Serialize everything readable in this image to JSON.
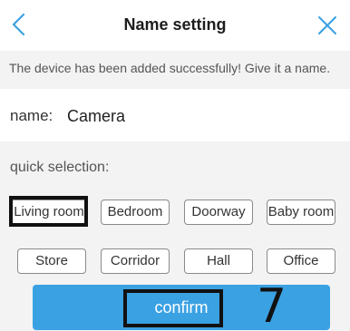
{
  "header": {
    "title": "Name setting",
    "back_icon": "chevron-left-icon",
    "close_icon": "close-icon",
    "accent_color": "#3aa1e3"
  },
  "banner": {
    "text": "The device has been added successfully! Give it a name."
  },
  "name_field": {
    "label": "name:",
    "value": "Camera"
  },
  "quick_selection": {
    "label": "quick selection:",
    "options": [
      "Living room",
      "Bedroom",
      "Doorway",
      "Baby room",
      "Store",
      "Corridor",
      "Hall",
      "Office"
    ]
  },
  "confirm_button": {
    "label": "confirm",
    "color": "#3aa1e3"
  },
  "annotation": {
    "step_number": "7",
    "highlighted_targets": [
      "Living room",
      "confirm"
    ]
  }
}
